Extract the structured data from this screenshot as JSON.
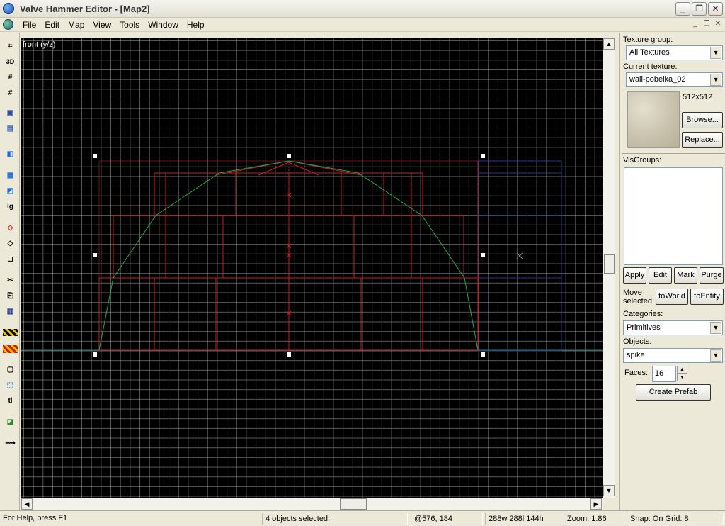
{
  "window": {
    "title": "Valve Hammer Editor - [Map2]"
  },
  "menu": [
    "File",
    "Edit",
    "Map",
    "View",
    "Tools",
    "Window",
    "Help"
  ],
  "viewport": {
    "label": "front (y/z)",
    "background": "#000000",
    "brush_color": "#d01c1c",
    "curve_color": "#23a653",
    "selection_color": "#1f3c8c"
  },
  "texture_panel": {
    "texture_group_label": "Texture group:",
    "texture_group_value": "All Textures",
    "current_texture_label": "Current texture:",
    "current_texture_value": "wall-pobelka_02",
    "texture_size": "512x512",
    "browse_label": "Browse...",
    "replace_label": "Replace..."
  },
  "visgroups": {
    "label": "VisGroups:",
    "apply": "Apply",
    "edit": "Edit",
    "mark": "Mark",
    "purge": "Purge"
  },
  "move": {
    "label_line1": "Move",
    "label_line2": "selected:",
    "to_world": "toWorld",
    "to_entity": "toEntity"
  },
  "objects_panel": {
    "categories_label": "Categories:",
    "categories_value": "Primitives",
    "objects_label": "Objects:",
    "objects_value": "spike",
    "faces_label": "Faces:",
    "faces_value": "16",
    "create_prefab": "Create Prefab"
  },
  "toolbar_icons": [
    "grid-icon",
    "3d-grid-icon",
    "smaller-grid-icon",
    "larger-grid-icon",
    "group-icon",
    "ungroup-icon",
    "hide-icon",
    "carve-icon",
    "clip-icon",
    "ignore-groups-icon",
    "select-red-icon",
    "morph-icon",
    "brush-icon",
    "cut-icon",
    "copy-icon",
    "paste-icon",
    "texture-lock-icon",
    "decal-icon",
    "select-tool-icon",
    "selection-tool-icon",
    "text-icon",
    "entity-icon",
    "path-icon"
  ],
  "status": {
    "help": "For Help, press F1",
    "selection": "4 objects selected.",
    "position": "@576, 184",
    "size": "288w 288l 144h",
    "zoom": "Zoom: 1.86",
    "snap": "Snap: On Grid: 8"
  }
}
